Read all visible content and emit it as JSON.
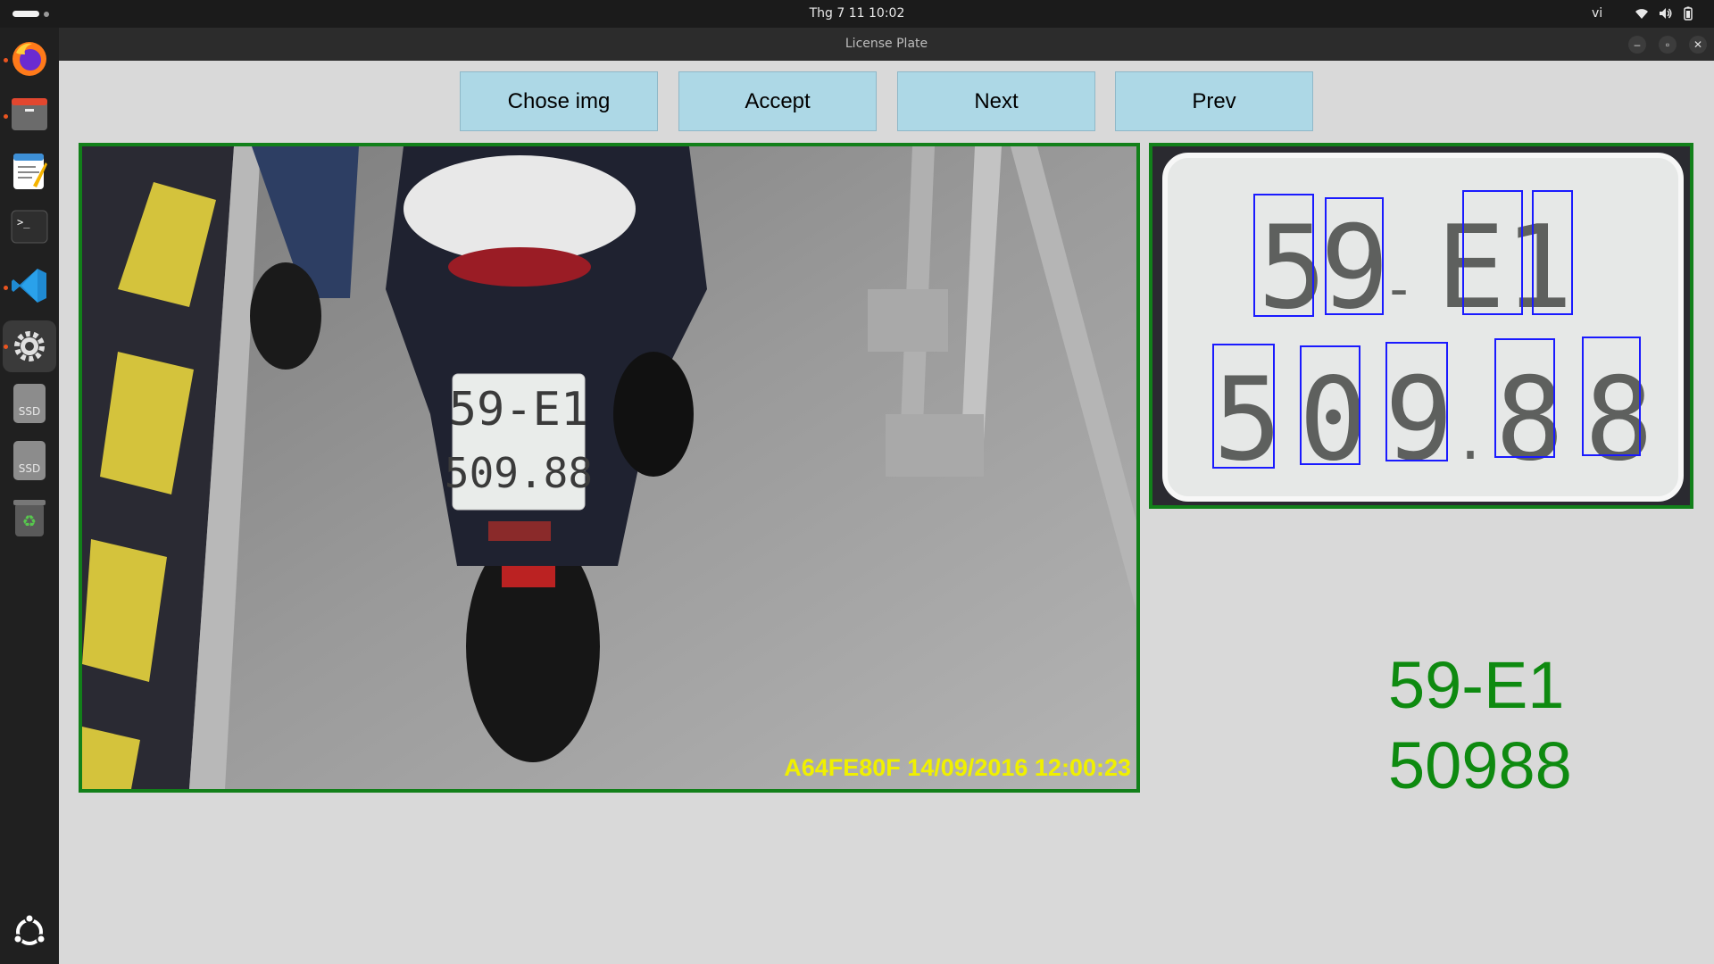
{
  "topbar": {
    "clock": "Thg 7 11  10:02",
    "language": "vi"
  },
  "dock": {
    "items": [
      {
        "name": "firefox",
        "icon": "firefox-icon"
      },
      {
        "name": "files",
        "icon": "folder-icon"
      },
      {
        "name": "text-editor",
        "icon": "text-editor-icon"
      },
      {
        "name": "terminal",
        "icon": "terminal-icon"
      },
      {
        "name": "vscode",
        "icon": "vscode-icon"
      },
      {
        "name": "settings",
        "icon": "gear-icon"
      },
      {
        "name": "ssd-1",
        "icon": "drive-icon",
        "label": "SSD"
      },
      {
        "name": "ssd-2",
        "icon": "drive-icon",
        "label": "SSD"
      },
      {
        "name": "trash",
        "icon": "trash-icon"
      }
    ]
  },
  "window": {
    "title": "License Plate"
  },
  "toolbar": {
    "choose_label": "Chose img",
    "accept_label": "Accept",
    "next_label": "Next",
    "prev_label": "Prev"
  },
  "camera": {
    "plate_line1": "59-E1",
    "plate_line2": "509.88",
    "overlay": "A64FE80F  14/09/2016 12:00:23"
  },
  "plate_crop": {
    "chars_top": [
      "5",
      "9",
      "-",
      "E",
      "1"
    ],
    "chars_bottom": [
      "5",
      "0",
      "9",
      ".",
      "8",
      "8"
    ]
  },
  "result": {
    "line1": "59-E1",
    "line2": "50988"
  },
  "colors": {
    "button_bg": "#add8e6",
    "frame_border": "#12801a",
    "result_text": "#0e8a10",
    "char_box": "#1a1aff"
  }
}
